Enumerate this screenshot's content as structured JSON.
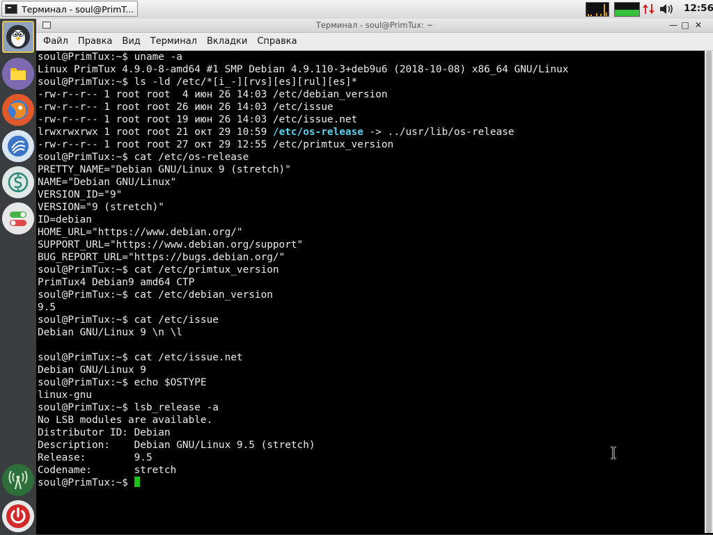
{
  "taskbar": {
    "task_label": "Терминал - soul@PrimT...",
    "clock": "12:56"
  },
  "colors": {
    "terminal_bg": "#000000",
    "terminal_fg": "#ececec",
    "symlink": "#5ad4ee",
    "cursor": "#18c018",
    "dock_bg": "#3a3d40",
    "cpu_graph": "#e8a020",
    "mem_graph": "#35c13a"
  },
  "dock": {
    "items": [
      {
        "name": "primtux-logo-icon"
      },
      {
        "name": "file-manager-icon"
      },
      {
        "name": "web-browser-icon"
      },
      {
        "name": "learning-apps-icon"
      },
      {
        "name": "education-tools-icon"
      },
      {
        "name": "settings-toggles-icon"
      },
      {
        "name": "wifi-antenna-icon"
      },
      {
        "name": "power-icon"
      }
    ]
  },
  "window": {
    "title": "Терминал - soul@PrimTux: ~",
    "menu": [
      "Файл",
      "Правка",
      "Вид",
      "Терминал",
      "Вкладки",
      "Справка"
    ]
  },
  "terminal": {
    "prompt": "soul@PrimTux:~$ ",
    "lines": [
      "soul@PrimTux:~$ uname -a",
      "Linux PrimTux 4.9.0-8-amd64 #1 SMP Debian 4.9.110-3+deb9u6 (2018-10-08) x86_64 GNU/Linux",
      "soul@PrimTux:~$ ls -ld /etc/*[i_-][rvs][es][rul][es]*",
      "-rw-r--r-- 1 root root  4 июн 26 14:03 /etc/debian_version",
      "-rw-r--r-- 1 root root 26 июн 26 14:03 /etc/issue",
      "-rw-r--r-- 1 root root 19 июн 26 14:03 /etc/issue.net",
      "lrwxrwxrwx 1 root root 21 окт 29 10:59 ",
      "-rw-r--r-- 1 root root 27 окт 29 12:55 /etc/primtux_version",
      "soul@PrimTux:~$ cat /etc/os-release",
      "PRETTY_NAME=\"Debian GNU/Linux 9 (stretch)\"",
      "NAME=\"Debian GNU/Linux\"",
      "VERSION_ID=\"9\"",
      "VERSION=\"9 (stretch)\"",
      "ID=debian",
      "HOME_URL=\"https://www.debian.org/\"",
      "SUPPORT_URL=\"https://www.debian.org/support\"",
      "BUG_REPORT_URL=\"https://bugs.debian.org/\"",
      "soul@PrimTux:~$ cat /etc/primtux_version",
      "PrimTux4 Debian9 amd64 CTP",
      "soul@PrimTux:~$ cat /etc/debian_version",
      "9.5",
      "soul@PrimTux:~$ cat /etc/issue",
      "Debian GNU/Linux 9 \\n \\l",
      "",
      "soul@PrimTux:~$ cat /etc/issue.net",
      "Debian GNU/Linux 9",
      "soul@PrimTux:~$ echo $OSTYPE",
      "linux-gnu",
      "soul@PrimTux:~$ lsb_release -a",
      "No LSB modules are available.",
      "Distributor ID: Debian",
      "Description:    Debian GNU/Linux 9.5 (stretch)",
      "Release:        9.5",
      "Codename:       stretch"
    ],
    "symlink_name": "/etc/os-release",
    "symlink_target": " -> ../usr/lib/os-release"
  }
}
